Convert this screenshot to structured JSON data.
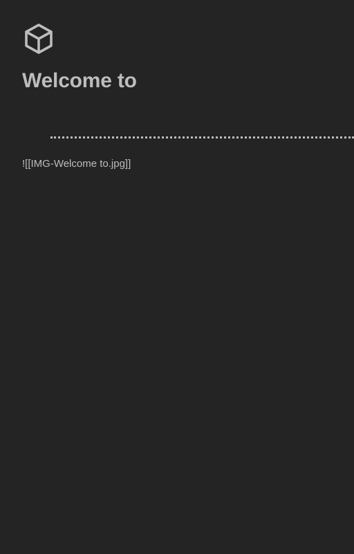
{
  "page": {
    "logo_icon": "cube-icon",
    "title": "Welcome to",
    "embed_text": "![[IMG-Welcome to.jpg]]"
  },
  "colors": {
    "background": "#242424",
    "foreground": "#bdbdbd"
  }
}
